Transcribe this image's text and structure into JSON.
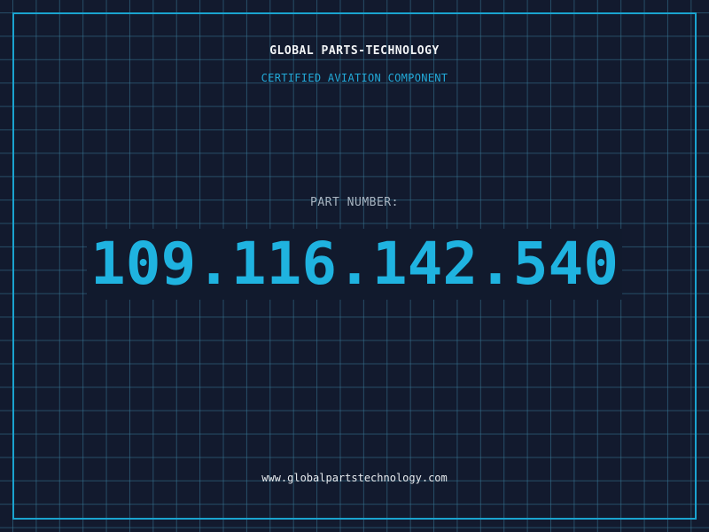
{
  "header": {
    "brand": "GLOBAL PARTS-TECHNOLOGY",
    "tagline": "CERTIFIED AVIATION COMPONENT"
  },
  "part": {
    "label": "PART NUMBER:",
    "number": "109.116.142.540"
  },
  "footer": {
    "url": "www.globalpartstechnology.com"
  },
  "colors": {
    "background": "#121a2e",
    "grid": "#38789a",
    "frame": "#1aa3cf",
    "accent": "#1fb3e0",
    "label": "#a8b4c0",
    "text": "#f2f4f6"
  }
}
